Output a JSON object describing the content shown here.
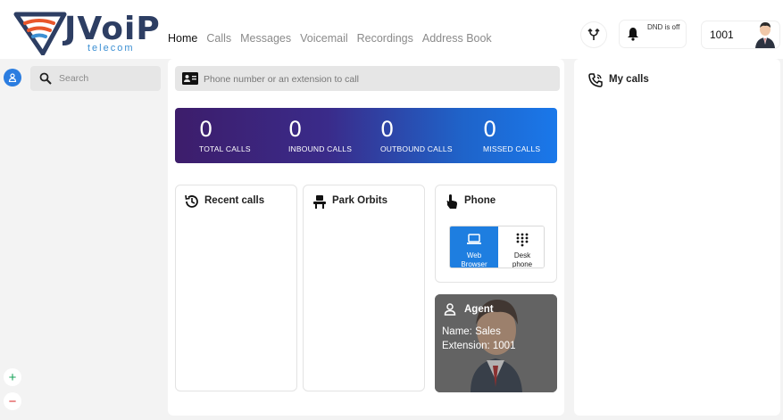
{
  "brand": {
    "name": "JVoiP",
    "tagline": "telecom",
    "colors": {
      "navy": "#2d3e63",
      "orange": "#e8562b",
      "blue": "#3b8fd3"
    }
  },
  "nav": {
    "items": [
      {
        "label": "Home",
        "active": true
      },
      {
        "label": "Calls",
        "active": false
      },
      {
        "label": "Messages",
        "active": false
      },
      {
        "label": "Voicemail",
        "active": false
      },
      {
        "label": "Recordings",
        "active": false
      },
      {
        "label": "Address Book",
        "active": false
      }
    ]
  },
  "header": {
    "dnd_status": "DND is off",
    "extension": "1001",
    "icons": {
      "transfer": "call-split-icon",
      "bell": "bell-icon",
      "avatar": "user-avatar"
    }
  },
  "sidebar": {
    "search_placeholder": "Search",
    "zoom_in": "+",
    "zoom_out": "−"
  },
  "dialer": {
    "placeholder": "Phone number or an extension to call"
  },
  "stats": [
    {
      "value": "0",
      "label": "TOTAL CALLS"
    },
    {
      "value": "0",
      "label": "INBOUND CALLS"
    },
    {
      "value": "0",
      "label": "OUTBOUND CALLS"
    },
    {
      "value": "0",
      "label": "MISSED CALLS"
    }
  ],
  "cards": {
    "recent_calls": "Recent calls",
    "park_orbits": "Park Orbits",
    "phone": "Phone",
    "web_browser_line1": "Web",
    "web_browser_line2": "Browser",
    "desk_phone_line1": "Desk",
    "desk_phone_line2": "phone"
  },
  "agent": {
    "title": "Agent",
    "name_line": "Name: Sales",
    "extension_line": "Extension: 1001"
  },
  "my_calls": {
    "title": "My calls"
  }
}
